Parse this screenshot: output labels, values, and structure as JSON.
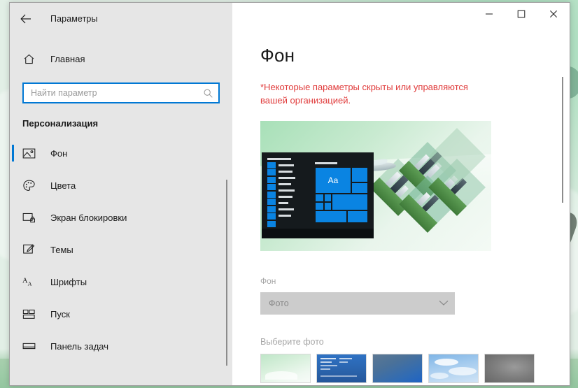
{
  "window": {
    "title": "Параметры",
    "back_icon": "back-arrow-icon",
    "minimize_label": "—",
    "maximize_label": "□",
    "close_label": "✕"
  },
  "sidebar": {
    "home": {
      "label": "Главная",
      "icon": "home-icon"
    },
    "search": {
      "placeholder": "Найти параметр",
      "value": "",
      "icon": "search-icon"
    },
    "section_title": "Персонализация",
    "items": [
      {
        "label": "Фон",
        "icon": "picture-icon",
        "selected": true
      },
      {
        "label": "Цвета",
        "icon": "palette-icon",
        "selected": false
      },
      {
        "label": "Экран блокировки",
        "icon": "lock-screen-icon",
        "selected": false
      },
      {
        "label": "Темы",
        "icon": "theme-brush-icon",
        "selected": false
      },
      {
        "label": "Шрифты",
        "icon": "fonts-icon",
        "selected": false
      },
      {
        "label": "Пуск",
        "icon": "start-tiles-icon",
        "selected": false
      },
      {
        "label": "Панель задач",
        "icon": "taskbar-icon",
        "selected": false
      }
    ]
  },
  "main": {
    "page_title": "Фон",
    "org_warning": "*Некоторые параметры скрыты или управляются вашей организацией.",
    "preview": {
      "name": "wallpaper-preview",
      "tile_text": "Aa"
    },
    "background_label": "Фон",
    "background_select": {
      "value": "Фото",
      "disabled": true,
      "chevron_icon": "chevron-down-icon"
    },
    "choose_photo_label": "Выберите фото",
    "thumbnails": [
      {
        "name": "thumbnail-green-landscape"
      },
      {
        "name": "thumbnail-blue-screen"
      },
      {
        "name": "thumbnail-blue-gradient"
      },
      {
        "name": "thumbnail-sky-clouds"
      },
      {
        "name": "thumbnail-grey-texture"
      }
    ]
  },
  "colors": {
    "accent": "#0078d4",
    "warning": "#e03a3a",
    "sidebar_bg": "#e6e6e6",
    "content_bg": "#ffffff",
    "disabled_control": "#cccccc",
    "desktop_green": "#7cc79b"
  }
}
